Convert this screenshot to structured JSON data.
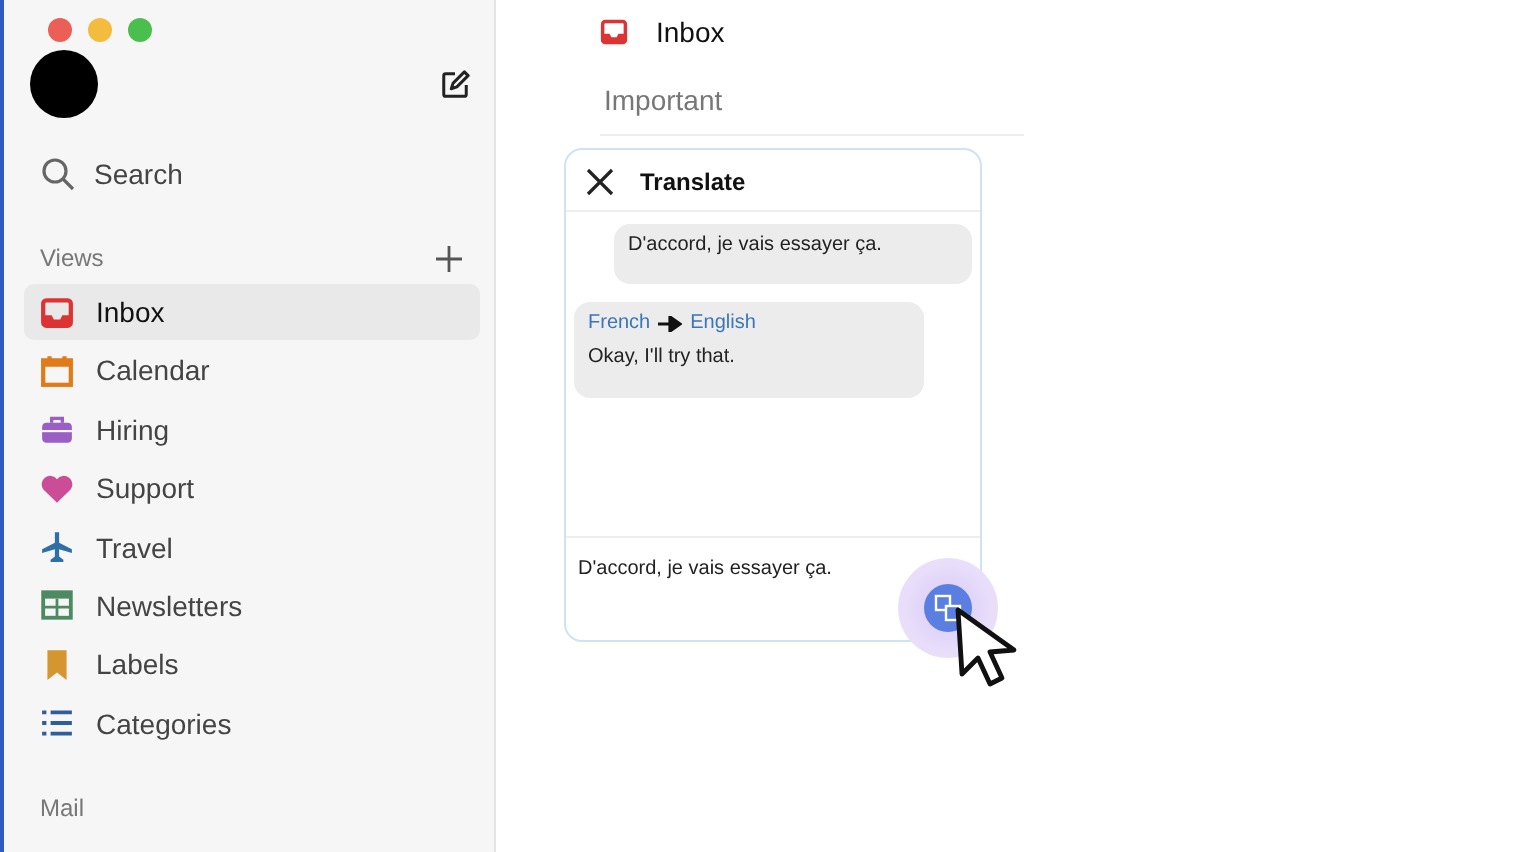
{
  "sidebar": {
    "search": "Search",
    "views_heading": "Views",
    "items": [
      {
        "label": "Inbox",
        "selected": true
      },
      {
        "label": "Calendar",
        "selected": false
      },
      {
        "label": "Hiring",
        "selected": false
      },
      {
        "label": "Support",
        "selected": false
      },
      {
        "label": "Travel",
        "selected": false
      },
      {
        "label": "Newsletters",
        "selected": false
      },
      {
        "label": "Labels",
        "selected": false
      },
      {
        "label": "Categories",
        "selected": false
      }
    ],
    "mail_heading": "Mail"
  },
  "main": {
    "title": "Inbox",
    "tab": "Important"
  },
  "translate": {
    "title": "Translate",
    "original": "D'accord, je vais essayer ça.",
    "from": "French",
    "to": "English",
    "translation": "Okay, I'll try that.",
    "input": "D'accord, je vais essayer ça."
  }
}
